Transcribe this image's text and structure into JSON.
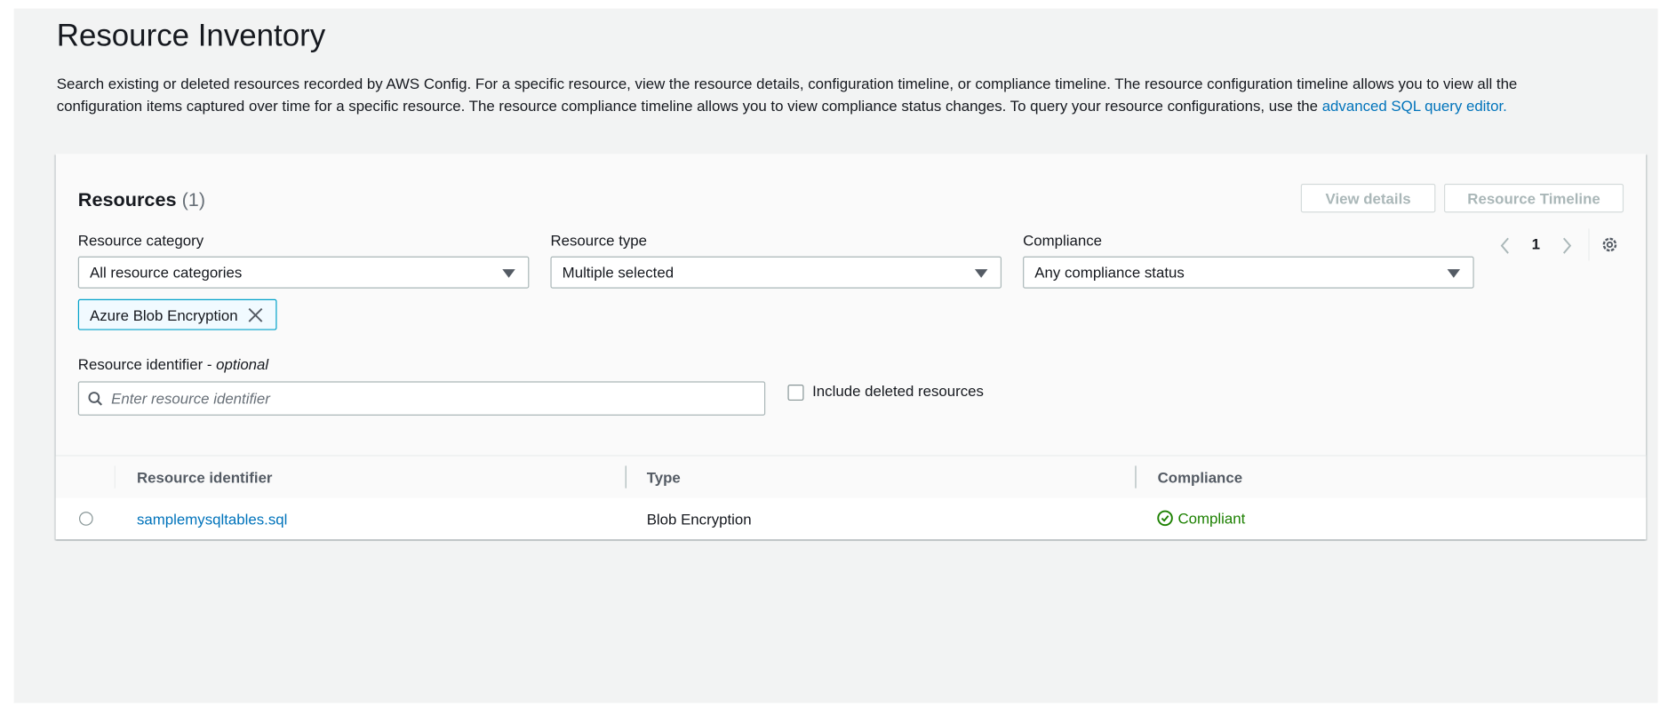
{
  "page": {
    "title": "Resource Inventory",
    "description": "Search existing or deleted resources recorded by AWS Config. For a specific resource, view the resource details, configuration timeline, or compliance timeline. The resource configuration timeline allows you to view all the configuration items captured over time for a specific resource. The resource compliance timeline allows you to view compliance status changes. To query your resource configurations, use the ",
    "description_link": "advanced SQL query editor."
  },
  "resources": {
    "heading": "Resources",
    "count": "(1)",
    "view_details_label": "View details",
    "resource_timeline_label": "Resource Timeline",
    "filters": {
      "category_label": "Resource category",
      "category_value": "All resource categories",
      "type_label": "Resource type",
      "type_value": "Multiple selected",
      "compliance_label": "Compliance",
      "compliance_value": "Any compliance status",
      "token": "Azure Blob Encryption",
      "identifier_label": "Resource identifier - ",
      "identifier_optional": "optional",
      "identifier_placeholder": "Enter resource identifier",
      "include_deleted_label": "Include deleted resources"
    },
    "pagination": {
      "current_page": "1"
    },
    "table": {
      "columns": [
        "Resource identifier",
        "Type",
        "Compliance"
      ],
      "rows": [
        {
          "identifier": "samplemysqltables.sql",
          "type": "Blob Encryption",
          "compliance": "Compliant"
        }
      ]
    }
  },
  "colors": {
    "link": "#0073bb",
    "compliant": "#1d8102",
    "token_border": "#00a1c9"
  }
}
